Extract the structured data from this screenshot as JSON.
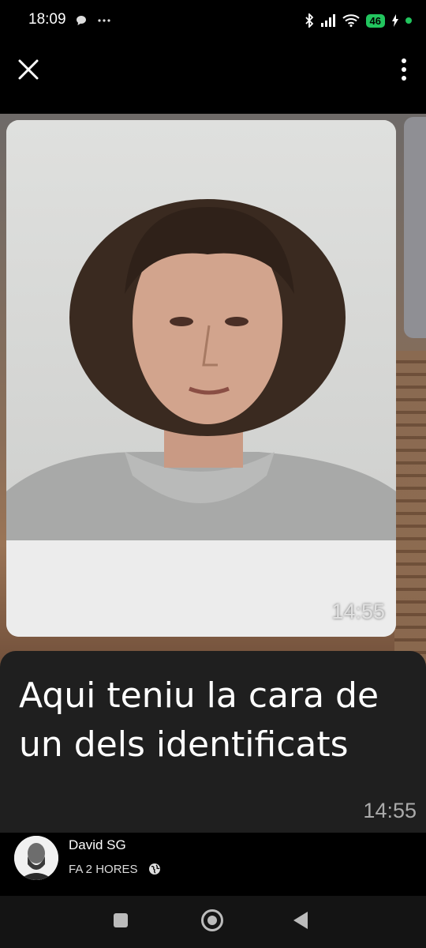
{
  "status": {
    "time": "18:09",
    "left_icons": [
      "chat-bubble-icon",
      "more-dots-icon"
    ],
    "battery": "46",
    "right_icons": [
      "bluetooth-icon",
      "signal-icon",
      "wifi-icon",
      "battery-icon",
      "charging-icon"
    ]
  },
  "toolbar": {
    "close_icon": "close-icon",
    "more_icon": "more-vertical-icon"
  },
  "story": {
    "photo_time": "14:55",
    "caption": "Aqui teniu la cara de un dels identificats",
    "caption_time": "14:55"
  },
  "author": {
    "name": "David SG",
    "posted": "FA 2 HORES",
    "visibility_icon": "globe-icon"
  },
  "navbar": {
    "buttons": [
      "recents-square-icon",
      "home-circle-icon",
      "back-triangle-icon"
    ]
  },
  "colors": {
    "accent_green": "#22c55e",
    "caption_bg": "#1f1f1f"
  }
}
